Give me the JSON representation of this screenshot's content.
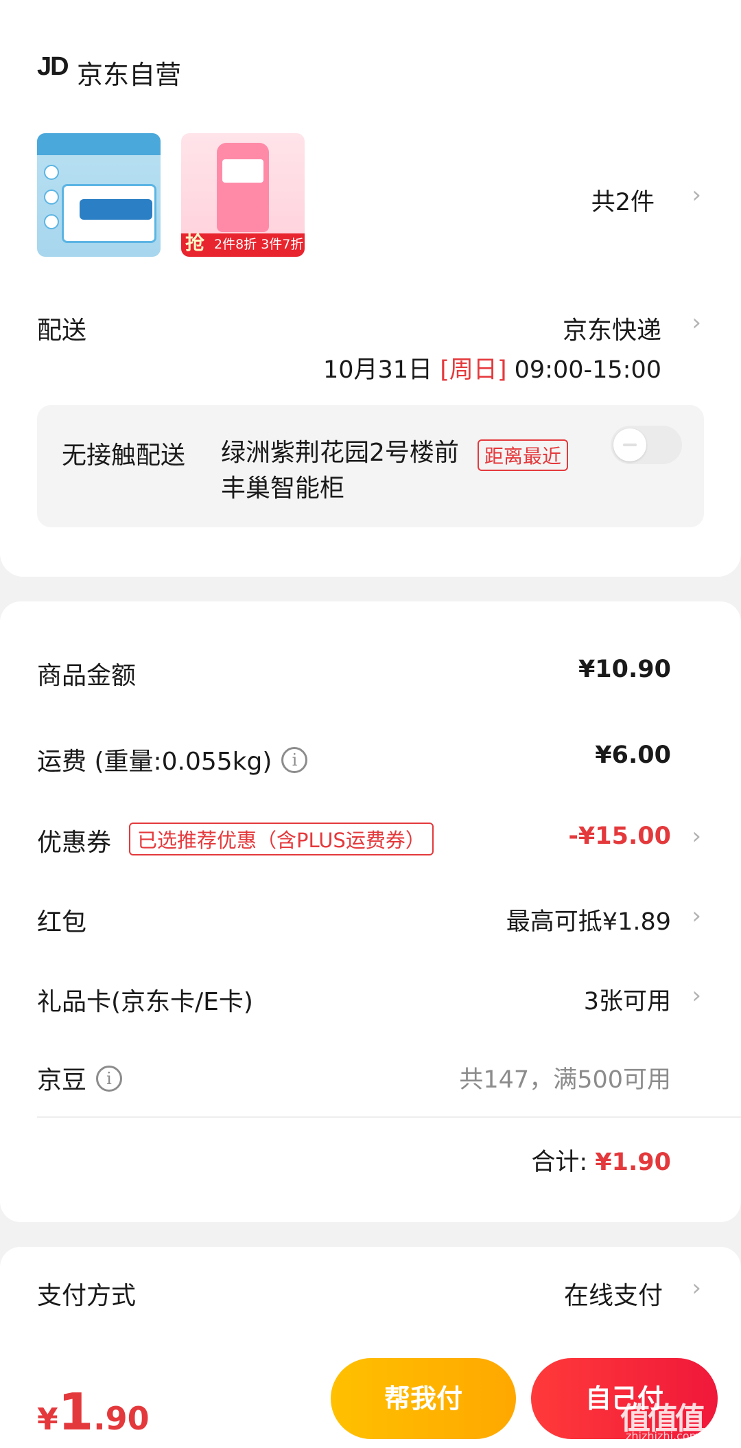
{
  "store": {
    "logo": "JD",
    "name": "京东自营"
  },
  "products": {
    "count_label": "共2件",
    "thumb2_badge": "抢",
    "thumb2_promo": "2件8折 3件7折"
  },
  "delivery": {
    "label": "配送",
    "method": "京东快递",
    "date": "10月31日",
    "weekday": "[周日]",
    "time": "09:00-15:00",
    "locker_label": "无接触配送",
    "locker_address": "绿洲紫荆花园2号楼前丰巢智能柜",
    "locker_tag": "距离最近",
    "locker_enabled": false
  },
  "price": {
    "goods_label": "商品金额",
    "goods_value": "¥10.90",
    "shipping_label": "运费 (重量:0.055kg)",
    "shipping_value": "¥6.00",
    "coupon_label": "优惠券",
    "coupon_tag": "已选推荐优惠（含PLUS运费券）",
    "coupon_value": "-¥15.00",
    "redpacket_label": "红包",
    "redpacket_value": "最高可抵¥1.89",
    "giftcard_label": "礼品卡(京东卡/E卡)",
    "giftcard_value": "3张可用",
    "jingdou_label": "京豆",
    "jingdou_value": "共147，满500可用",
    "total_label": "合计:",
    "total_value": "¥1.90"
  },
  "payment": {
    "label": "支付方式",
    "value": "在线支付"
  },
  "bottom": {
    "currency": "¥",
    "total_int": "1",
    "total_dec": ".90",
    "help_pay": "帮我付",
    "self_pay": "自己付",
    "watermark": "值值值",
    "watermark_url": "zhizhizhi.com"
  },
  "colors": {
    "accent_red": "#e4393c",
    "help_button": "#ffb300",
    "self_button": "#f5223a"
  },
  "icons": [
    "info-icon",
    "chevron-right-icon"
  ]
}
